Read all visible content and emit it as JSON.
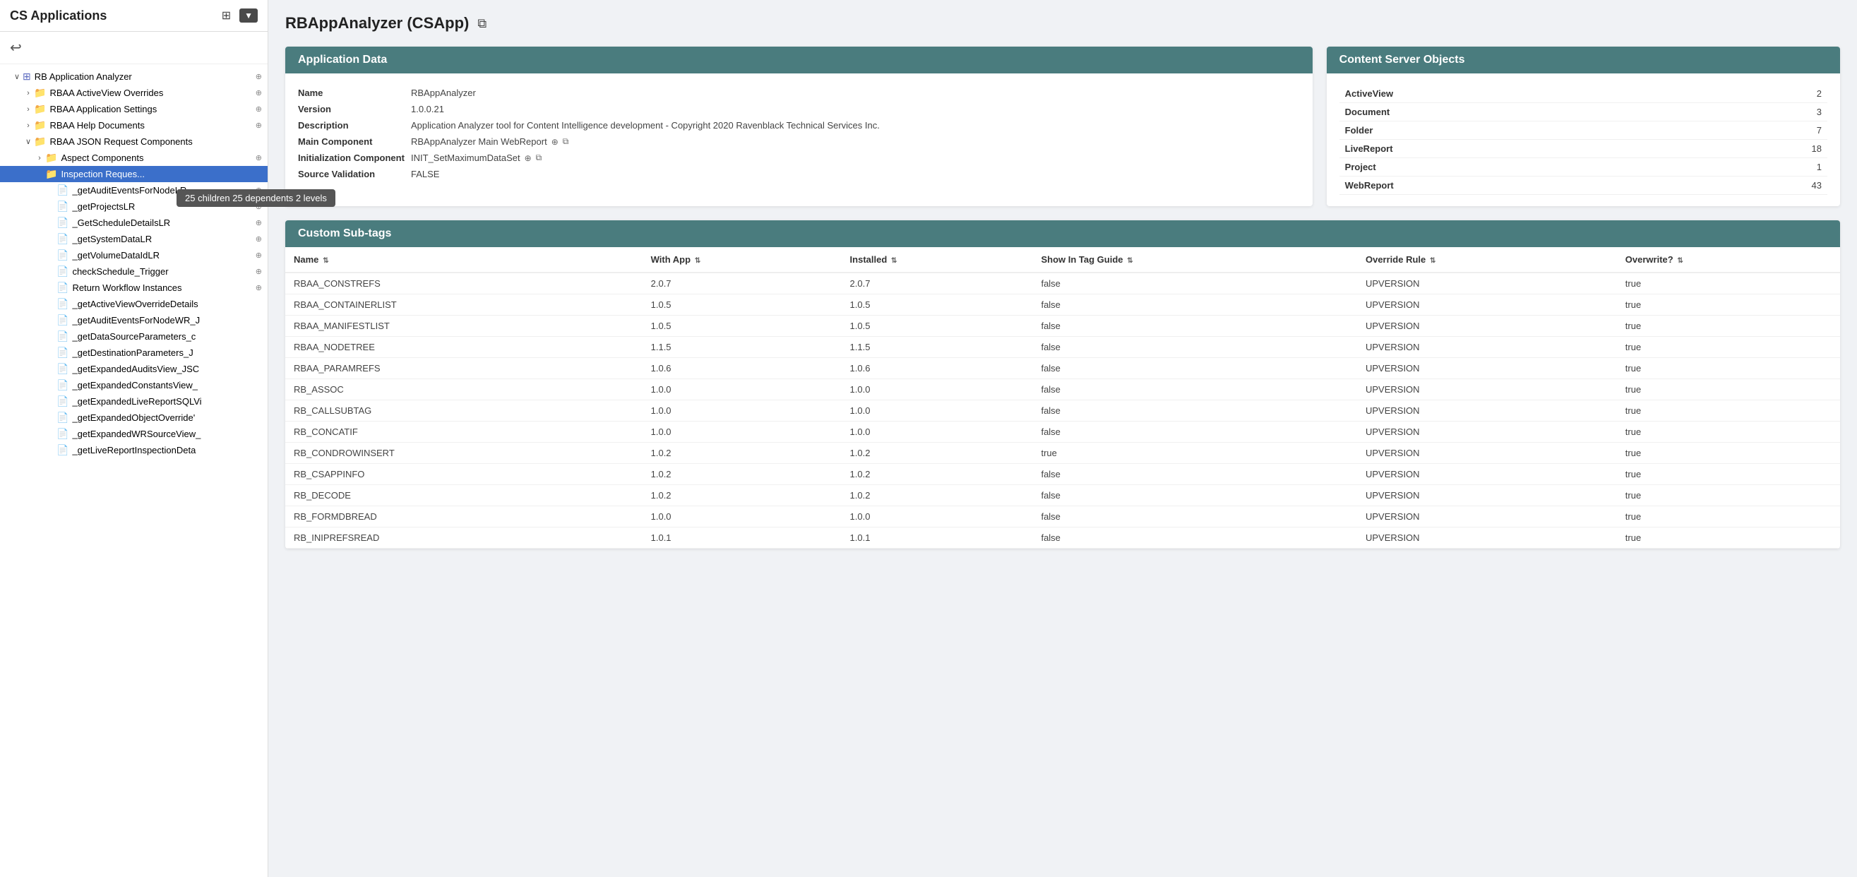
{
  "sidebar": {
    "title": "CS Applications",
    "back_icon": "←",
    "network_icon": "⊞",
    "dropdown_arrow": "▼",
    "tree": [
      {
        "id": "rb-app-analyzer",
        "label": "RB Application Analyzer",
        "indent": 1,
        "expander": "∨",
        "icon_type": "app",
        "icon": "⊞",
        "pin": true
      },
      {
        "id": "rbaa-activeview",
        "label": "RBAA ActiveView Overrides",
        "indent": 2,
        "expander": "›",
        "icon_type": "folder",
        "pin": true
      },
      {
        "id": "rbaa-app-settings",
        "label": "RBAA Application Settings",
        "indent": 2,
        "expander": "›",
        "icon_type": "folder",
        "pin": true
      },
      {
        "id": "rbaa-help-docs",
        "label": "RBAA Help Documents",
        "indent": 2,
        "expander": "›",
        "icon_type": "folder",
        "pin": true
      },
      {
        "id": "rbaa-json-req",
        "label": "RBAA JSON Request Components",
        "indent": 2,
        "expander": "∨",
        "icon_type": "folder",
        "pin": false
      },
      {
        "id": "aspect-components",
        "label": "Aspect Components",
        "indent": 3,
        "expander": "›",
        "icon_type": "folder",
        "pin": true
      },
      {
        "id": "inspection-reques",
        "label": "Inspection Reques...",
        "indent": 3,
        "expander": "",
        "icon_type": "folder-blue",
        "pin": false,
        "selected": true,
        "highlighted": true
      },
      {
        "id": "getAuditEventsLR",
        "label": "_getAuditEventsForNodeLR",
        "indent": 4,
        "expander": "",
        "icon_type": "doc-red",
        "pin": true
      },
      {
        "id": "getProjectsLR",
        "label": "_getProjectsLR",
        "indent": 4,
        "expander": "",
        "icon_type": "doc-red",
        "pin": true
      },
      {
        "id": "getScheduleDetailsLR",
        "label": "_GetScheduleDetailsLR",
        "indent": 4,
        "expander": "",
        "icon_type": "doc-red",
        "pin": true
      },
      {
        "id": "getSystemDataLR",
        "label": "_getSystemDataLR",
        "indent": 4,
        "expander": "",
        "icon_type": "doc-red",
        "pin": true
      },
      {
        "id": "getVolumeDataIdLR",
        "label": "_getVolumeDataIdLR",
        "indent": 4,
        "expander": "",
        "icon_type": "doc-red",
        "pin": true
      },
      {
        "id": "checkScheduleTrigger",
        "label": "checkSchedule_Trigger",
        "indent": 4,
        "expander": "",
        "icon_type": "doc-red",
        "pin": true
      },
      {
        "id": "returnWorkflow",
        "label": "Return Workflow Instances",
        "indent": 4,
        "expander": "",
        "icon_type": "doc-red",
        "pin": true
      },
      {
        "id": "getActiveViewOverride",
        "label": "_getActiveViewOverrideDetails",
        "indent": 4,
        "expander": "",
        "icon_type": "doc-green",
        "pin": false
      },
      {
        "id": "getAuditEventsWR",
        "label": "_getAuditEventsForNodeWR_J",
        "indent": 4,
        "expander": "",
        "icon_type": "doc-green",
        "pin": false
      },
      {
        "id": "getDataSourceParams",
        "label": "_getDataSourceParameters_c",
        "indent": 4,
        "expander": "",
        "icon_type": "doc-green",
        "pin": false
      },
      {
        "id": "getDestinationParams",
        "label": "_getDestinationParameters_J",
        "indent": 4,
        "expander": "",
        "icon_type": "doc-green",
        "pin": false
      },
      {
        "id": "getExpandedAudits",
        "label": "_getExpandedAuditsView_JSC",
        "indent": 4,
        "expander": "",
        "icon_type": "doc-green",
        "pin": false
      },
      {
        "id": "getExpandedConstants",
        "label": "_getExpandedConstantsView_",
        "indent": 4,
        "expander": "",
        "icon_type": "doc-green",
        "pin": false
      },
      {
        "id": "getExpandedLiveReport",
        "label": "_getExpandedLiveReportSQLVi",
        "indent": 4,
        "expander": "",
        "icon_type": "doc-green",
        "pin": false
      },
      {
        "id": "getExpandedObjectOverride",
        "label": "_getExpandedObjectOverride'",
        "indent": 4,
        "expander": "",
        "icon_type": "doc-green",
        "pin": false
      },
      {
        "id": "getExpandedWRSource",
        "label": "_getExpandedWRSourceView_",
        "indent": 4,
        "expander": "",
        "icon_type": "doc-green",
        "pin": false
      },
      {
        "id": "getLiveReportInspection",
        "label": "_getLiveReportInspectionDeta",
        "indent": 4,
        "expander": "",
        "icon_type": "doc-green",
        "pin": false
      }
    ],
    "tooltip": "25 children 25 dependents 2 levels"
  },
  "main": {
    "title": "RBAppAnalyzer (CSApp)",
    "application_data": {
      "header": "Application Data",
      "fields": [
        {
          "label": "Name",
          "value": "RBAppAnalyzer"
        },
        {
          "label": "Version",
          "value": "1.0.0.21"
        },
        {
          "label": "Description",
          "value": "Application Analyzer tool for Content Intelligence development - Copyright 2020 Ravenblack Technical Services Inc."
        },
        {
          "label": "Main Component",
          "value": "RBAppAnalyzer Main WebReport",
          "has_icons": true
        },
        {
          "label": "Initialization Component",
          "value": "INIT_SetMaximumDataSet",
          "has_icons": true
        },
        {
          "label": "Source Validation",
          "value": "FALSE"
        }
      ]
    },
    "cs_objects": {
      "header": "Content Server Objects",
      "items": [
        {
          "label": "ActiveView",
          "value": "2"
        },
        {
          "label": "Document",
          "value": "3"
        },
        {
          "label": "Folder",
          "value": "7"
        },
        {
          "label": "LiveReport",
          "value": "18"
        },
        {
          "label": "Project",
          "value": "1"
        },
        {
          "label": "WebReport",
          "value": "43"
        }
      ]
    },
    "custom_subtags": {
      "header": "Custom Sub-tags",
      "columns": [
        {
          "label": "Name",
          "sortable": true
        },
        {
          "label": "With App",
          "sortable": true
        },
        {
          "label": "Installed",
          "sortable": true
        },
        {
          "label": "Show In Tag Guide",
          "sortable": true
        },
        {
          "label": "Override Rule",
          "sortable": true
        },
        {
          "label": "Overwrite?",
          "sortable": true
        }
      ],
      "rows": [
        {
          "name": "RBAA_CONSTREFS",
          "with_app": "2.0.7",
          "installed": "2.0.7",
          "show_in_tag_guide": "false",
          "override_rule": "UPVERSION",
          "overwrite": "true"
        },
        {
          "name": "RBAA_CONTAINERLIST",
          "with_app": "1.0.5",
          "installed": "1.0.5",
          "show_in_tag_guide": "false",
          "override_rule": "UPVERSION",
          "overwrite": "true"
        },
        {
          "name": "RBAA_MANIFESTLIST",
          "with_app": "1.0.5",
          "installed": "1.0.5",
          "show_in_tag_guide": "false",
          "override_rule": "UPVERSION",
          "overwrite": "true"
        },
        {
          "name": "RBAA_NODETREE",
          "with_app": "1.1.5",
          "installed": "1.1.5",
          "show_in_tag_guide": "false",
          "override_rule": "UPVERSION",
          "overwrite": "true"
        },
        {
          "name": "RBAA_PARAMREFS",
          "with_app": "1.0.6",
          "installed": "1.0.6",
          "show_in_tag_guide": "false",
          "override_rule": "UPVERSION",
          "overwrite": "true"
        },
        {
          "name": "RB_ASSOC",
          "with_app": "1.0.0",
          "installed": "1.0.0",
          "show_in_tag_guide": "false",
          "override_rule": "UPVERSION",
          "overwrite": "true"
        },
        {
          "name": "RB_CALLSUBTAG",
          "with_app": "1.0.0",
          "installed": "1.0.0",
          "show_in_tag_guide": "false",
          "override_rule": "UPVERSION",
          "overwrite": "true"
        },
        {
          "name": "RB_CONCATIF",
          "with_app": "1.0.0",
          "installed": "1.0.0",
          "show_in_tag_guide": "false",
          "override_rule": "UPVERSION",
          "overwrite": "true"
        },
        {
          "name": "RB_CONDROWINSERT",
          "with_app": "1.0.2",
          "installed": "1.0.2",
          "show_in_tag_guide": "true",
          "override_rule": "UPVERSION",
          "overwrite": "true"
        },
        {
          "name": "RB_CSAPPINFO",
          "with_app": "1.0.2",
          "installed": "1.0.2",
          "show_in_tag_guide": "false",
          "override_rule": "UPVERSION",
          "overwrite": "true"
        },
        {
          "name": "RB_DECODE",
          "with_app": "1.0.2",
          "installed": "1.0.2",
          "show_in_tag_guide": "false",
          "override_rule": "UPVERSION",
          "overwrite": "true"
        },
        {
          "name": "RB_FORMDBREAD",
          "with_app": "1.0.0",
          "installed": "1.0.0",
          "show_in_tag_guide": "false",
          "override_rule": "UPVERSION",
          "overwrite": "true"
        },
        {
          "name": "RB_INIPREFSREAD",
          "with_app": "1.0.1",
          "installed": "1.0.1",
          "show_in_tag_guide": "false",
          "override_rule": "UPVERSION",
          "overwrite": "true"
        }
      ]
    }
  },
  "icons": {
    "network": "⊞",
    "dropdown": "▼",
    "back": "↩",
    "external_link": "⧉",
    "pin": "⊕",
    "sort": "⇅",
    "expand_open": "∨",
    "expand_closed": "›",
    "link": "⧉",
    "bookmark": "⊕"
  }
}
